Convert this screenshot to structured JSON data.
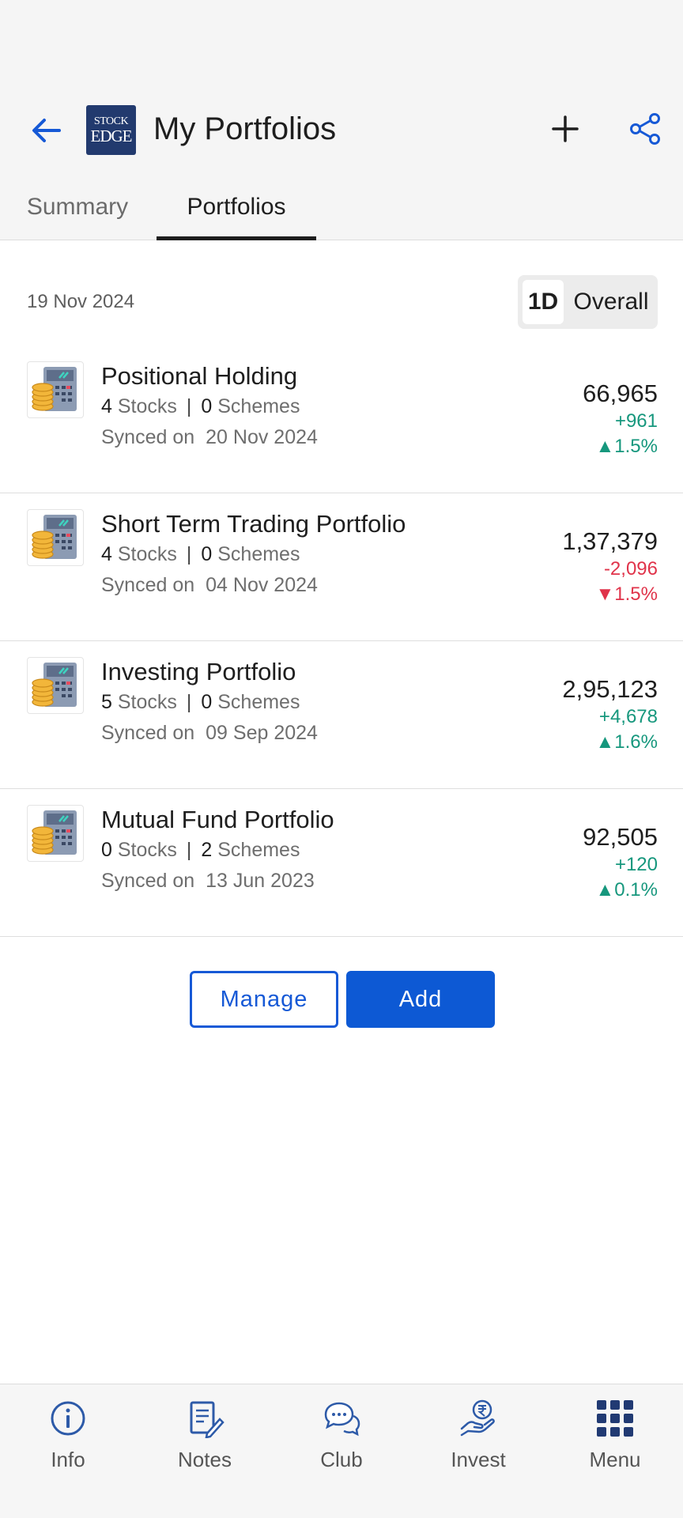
{
  "header": {
    "title": "My Portfolios",
    "logo_line1": "STOCK",
    "logo_line2": "EDGE"
  },
  "tabs": [
    {
      "label": "Summary",
      "active": false
    },
    {
      "label": "Portfolios",
      "active": true
    }
  ],
  "date": "19 Nov 2024",
  "toggle": {
    "options": [
      "1D",
      "Overall"
    ],
    "selected": "1D"
  },
  "portfolios": [
    {
      "name": "Positional Holding",
      "stocks": "4",
      "stocks_label": "Stocks",
      "schemes": "0",
      "schemes_label": "Schemes",
      "synced_label": "Synced on",
      "synced_date": "20 Nov 2024",
      "value": "66,965",
      "change": "+961",
      "pct": "▲1.5%",
      "trend": "up"
    },
    {
      "name": "Short Term Trading Portfolio",
      "stocks": "4",
      "stocks_label": "Stocks",
      "schemes": "0",
      "schemes_label": "Schemes",
      "synced_label": "Synced on",
      "synced_date": "04 Nov 2024",
      "value": "1,37,379",
      "change": "-2,096",
      "pct": "▼1.5%",
      "trend": "down"
    },
    {
      "name": "Investing Portfolio",
      "stocks": "5",
      "stocks_label": "Stocks",
      "schemes": "0",
      "schemes_label": "Schemes",
      "synced_label": "Synced on",
      "synced_date": "09 Sep 2024",
      "value": "2,95,123",
      "change": "+4,678",
      "pct": "▲1.6%",
      "trend": "up"
    },
    {
      "name": "Mutual Fund Portfolio",
      "stocks": "0",
      "stocks_label": "Stocks",
      "schemes": "2",
      "schemes_label": "Schemes",
      "synced_label": "Synced on",
      "synced_date": "13 Jun 2023",
      "value": "92,505",
      "change": "+120",
      "pct": "▲0.1%",
      "trend": "up"
    }
  ],
  "actions": {
    "manage": "Manage",
    "add": "Add"
  },
  "bottom_nav": [
    {
      "label": "Info",
      "icon": "info-icon"
    },
    {
      "label": "Notes",
      "icon": "notes-icon"
    },
    {
      "label": "Club",
      "icon": "chat-bubbles-icon"
    },
    {
      "label": "Invest",
      "icon": "rupee-hand-icon"
    },
    {
      "label": "Menu",
      "icon": "grid-menu-icon"
    }
  ],
  "colors": {
    "accent": "#0d59d4",
    "up": "#16977d",
    "down": "#e0334a",
    "logo_bg": "#223a6e"
  }
}
